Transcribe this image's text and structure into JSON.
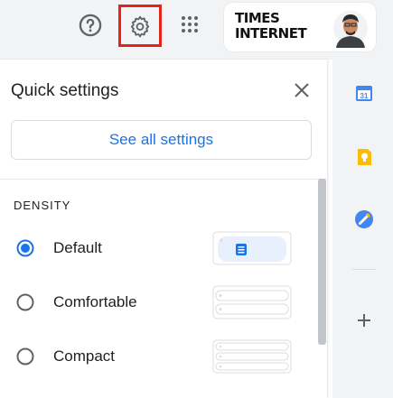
{
  "header": {
    "brand_line1": "TIMES",
    "brand_line2": "INTERNET"
  },
  "quick_settings": {
    "title": "Quick settings",
    "see_all_label": "See all settings",
    "density_heading": "DENSITY",
    "options": [
      {
        "label": "Default",
        "selected": true
      },
      {
        "label": "Comfortable",
        "selected": false
      },
      {
        "label": "Compact",
        "selected": false
      }
    ]
  },
  "side_apps": [
    "calendar-icon",
    "keep-icon",
    "tasks-icon",
    "add-icon"
  ],
  "colors": {
    "accent": "#1a73e8",
    "highlight": "#e1251b"
  }
}
